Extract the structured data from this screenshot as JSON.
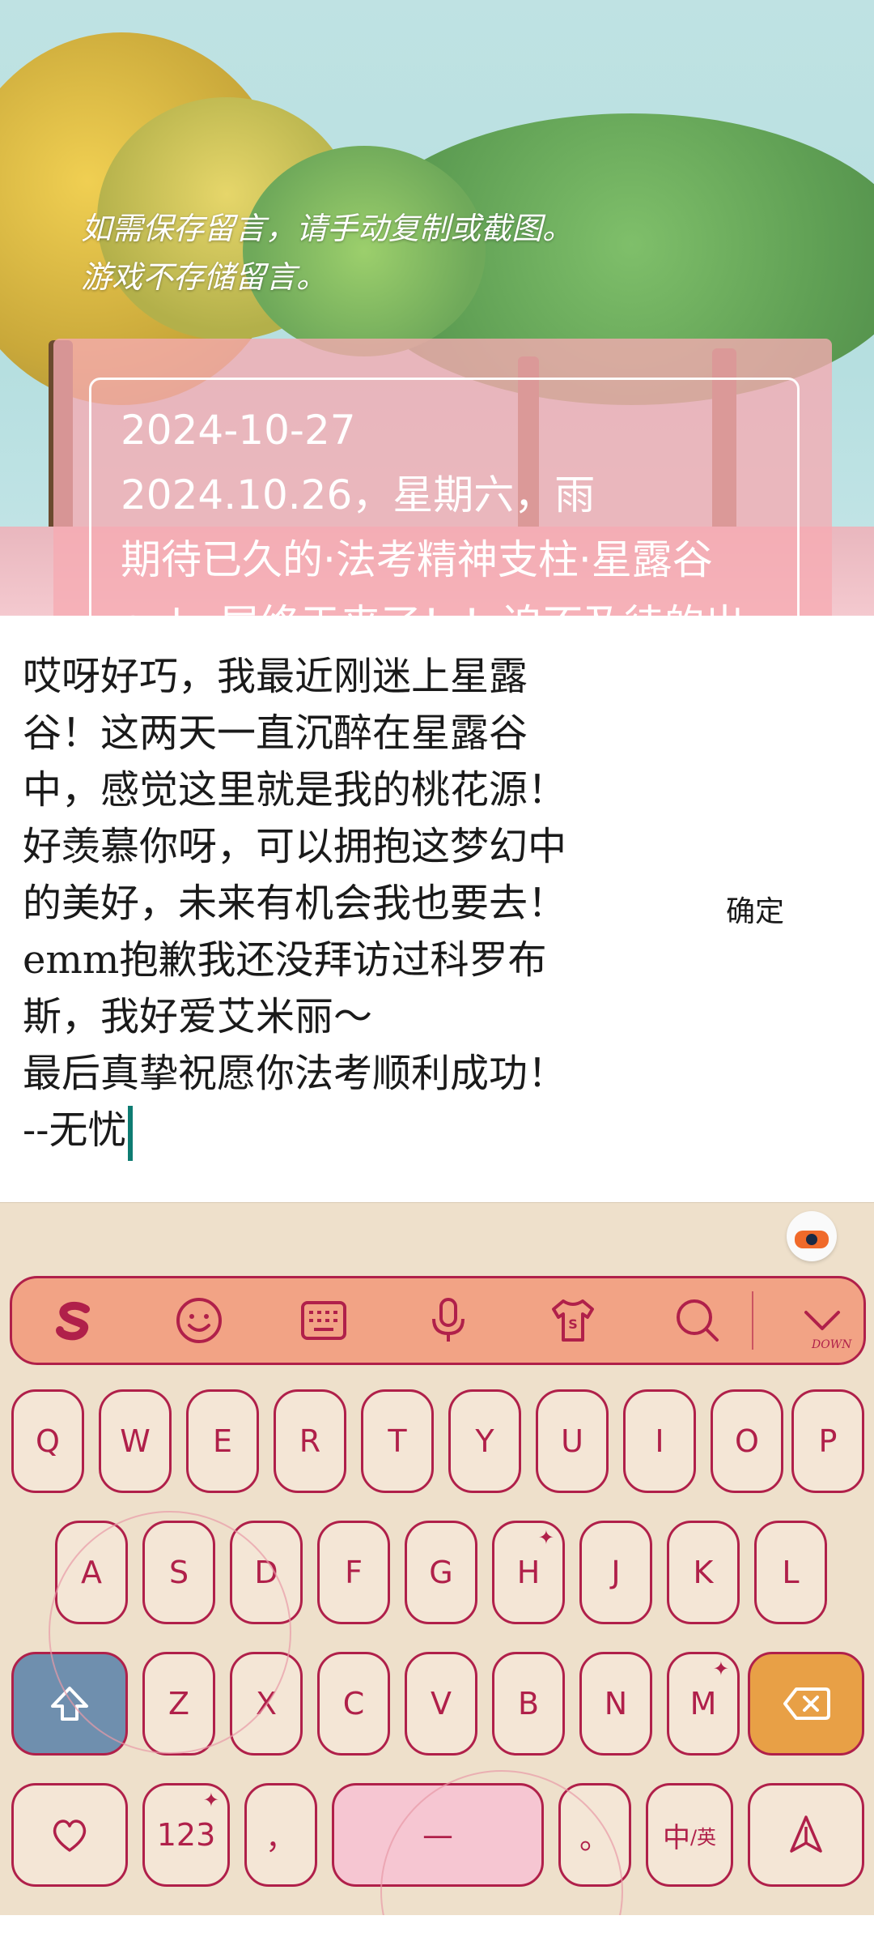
{
  "notice": {
    "line1": "如需保存留言，请手动复制或截图。",
    "line2": "游戏不存储留言。"
  },
  "letter": {
    "lines": [
      "2024-10-27",
      "2024.10.26，星期六，雨",
      "期待已久的·法考精神支柱·星露谷",
      "only 屋终于来了！！迫不及待的出"
    ]
  },
  "input": {
    "lines": [
      "哎呀好巧，我最近刚迷上星露",
      "谷！这两天一直沉醉在星露谷",
      "中，感觉这里就是我的桃花源！",
      "好羡慕你呀，可以拥抱这梦幻中",
      "的美好，未来有机会我也要去！",
      "emm抱歉我还没拜访过科罗布",
      "斯，我好爱艾米丽～",
      "最后真挚祝愿你法考顺利成功！",
      "--无忧"
    ],
    "confirm_label": "确定"
  },
  "keyboard": {
    "toolbar": {
      "icons": [
        "sogou-logo-icon",
        "emoji-icon",
        "keyboard-icon",
        "microphone-icon",
        "skin-shirt-icon",
        "search-icon",
        "collapse-chevron-icon"
      ],
      "collapse_label": "DOWN"
    },
    "row1": [
      "Q",
      "W",
      "E",
      "R",
      "T",
      "Y",
      "U",
      "I",
      "O",
      "P"
    ],
    "row2": [
      "A",
      "S",
      "D",
      "F",
      "G",
      "H",
      "J",
      "K",
      "L"
    ],
    "row3": [
      "Z",
      "X",
      "C",
      "V",
      "B",
      "N",
      "M"
    ],
    "bottom": {
      "favorite_icon": "heart-icon",
      "numbers_label": "123",
      "comma_label": "，",
      "space_label": "—",
      "period_label": "。",
      "lang_label_main": "中",
      "lang_label_sub": "/英",
      "send_icon": "paper-plane-icon"
    },
    "accent_colors": {
      "key_border": "#b0204a",
      "key_fill": "#f4e6d6",
      "toolbar_fill": "#f2a385",
      "shift_fill": "#6f8fae",
      "backspace_fill": "#e8a046",
      "space_fill": "#f6c6d2"
    }
  }
}
